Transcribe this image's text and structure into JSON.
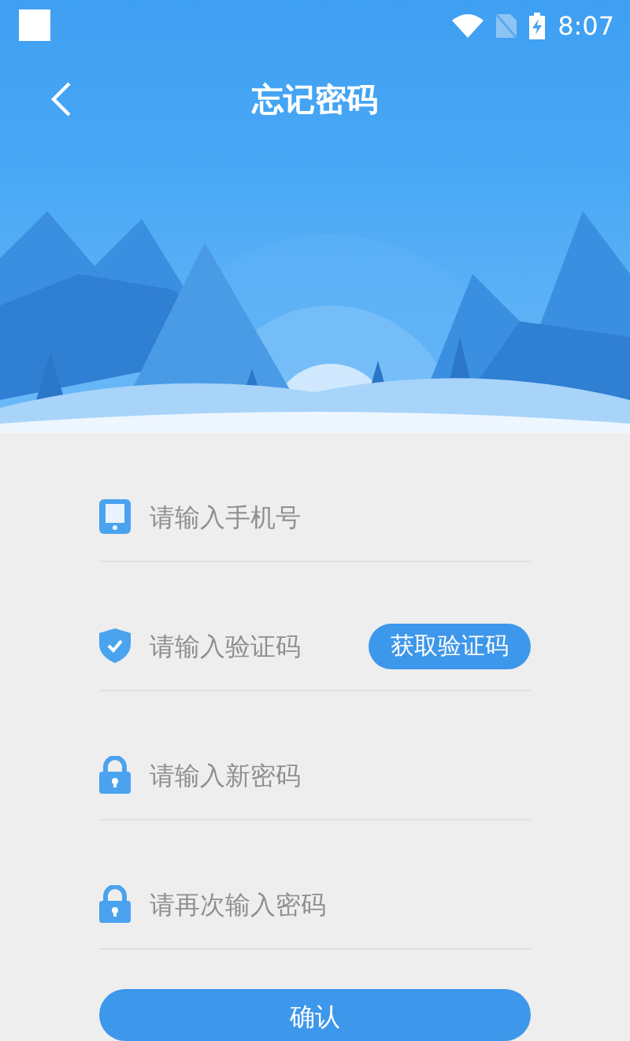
{
  "status_bar": {
    "time": "8:07"
  },
  "header": {
    "title": "忘记密码"
  },
  "form": {
    "fields": [
      {
        "kind": "phone",
        "placeholder": "请输入手机号"
      },
      {
        "kind": "code",
        "placeholder": "请输入验证码",
        "action": "获取验证码"
      },
      {
        "kind": "password",
        "placeholder": "请输入新密码"
      },
      {
        "kind": "password",
        "placeholder": "请再次输入密码"
      }
    ]
  },
  "submit": "确认"
}
